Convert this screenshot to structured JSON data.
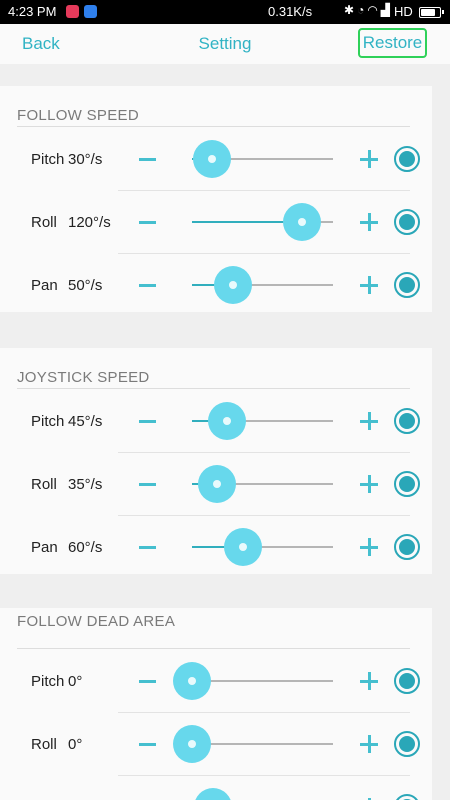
{
  "status_bar": {
    "time": "4:23 PM",
    "network_speed": "0.31K/s",
    "network_type": "HD",
    "icons": [
      "bluetooth-icon",
      "alarm-icon",
      "wifi-icon",
      "signal-icon",
      "battery-icon"
    ],
    "battery_level": 0.85
  },
  "header": {
    "back_label": "Back",
    "title": "Setting",
    "restore_label": "Restore"
  },
  "colors": {
    "accent": "#31b3c4",
    "thumb": "#67d8ec",
    "restore_border": "#2fd159"
  },
  "sections": [
    {
      "title": "FOLLOW SPEED",
      "rows": [
        {
          "label": "Pitch",
          "value": "30°/s",
          "level": 0.14
        },
        {
          "label": "Roll",
          "value": "120°/s",
          "level": 0.78
        },
        {
          "label": "Pan",
          "value": "50°/s",
          "level": 0.29
        }
      ]
    },
    {
      "title": "JOYSTICK SPEED",
      "rows": [
        {
          "label": "Pitch",
          "value": "45°/s",
          "level": 0.25
        },
        {
          "label": "Roll",
          "value": "35°/s",
          "level": 0.18
        },
        {
          "label": "Pan",
          "value": "60°/s",
          "level": 0.36
        }
      ]
    },
    {
      "title": "FOLLOW DEAD AREA",
      "rows": [
        {
          "label": "Pitch",
          "value": "0°",
          "level": 0.0
        },
        {
          "label": "Roll",
          "value": "0°",
          "level": 0.0
        },
        {
          "label": "",
          "value": "",
          "level": 0.15
        }
      ]
    }
  ]
}
